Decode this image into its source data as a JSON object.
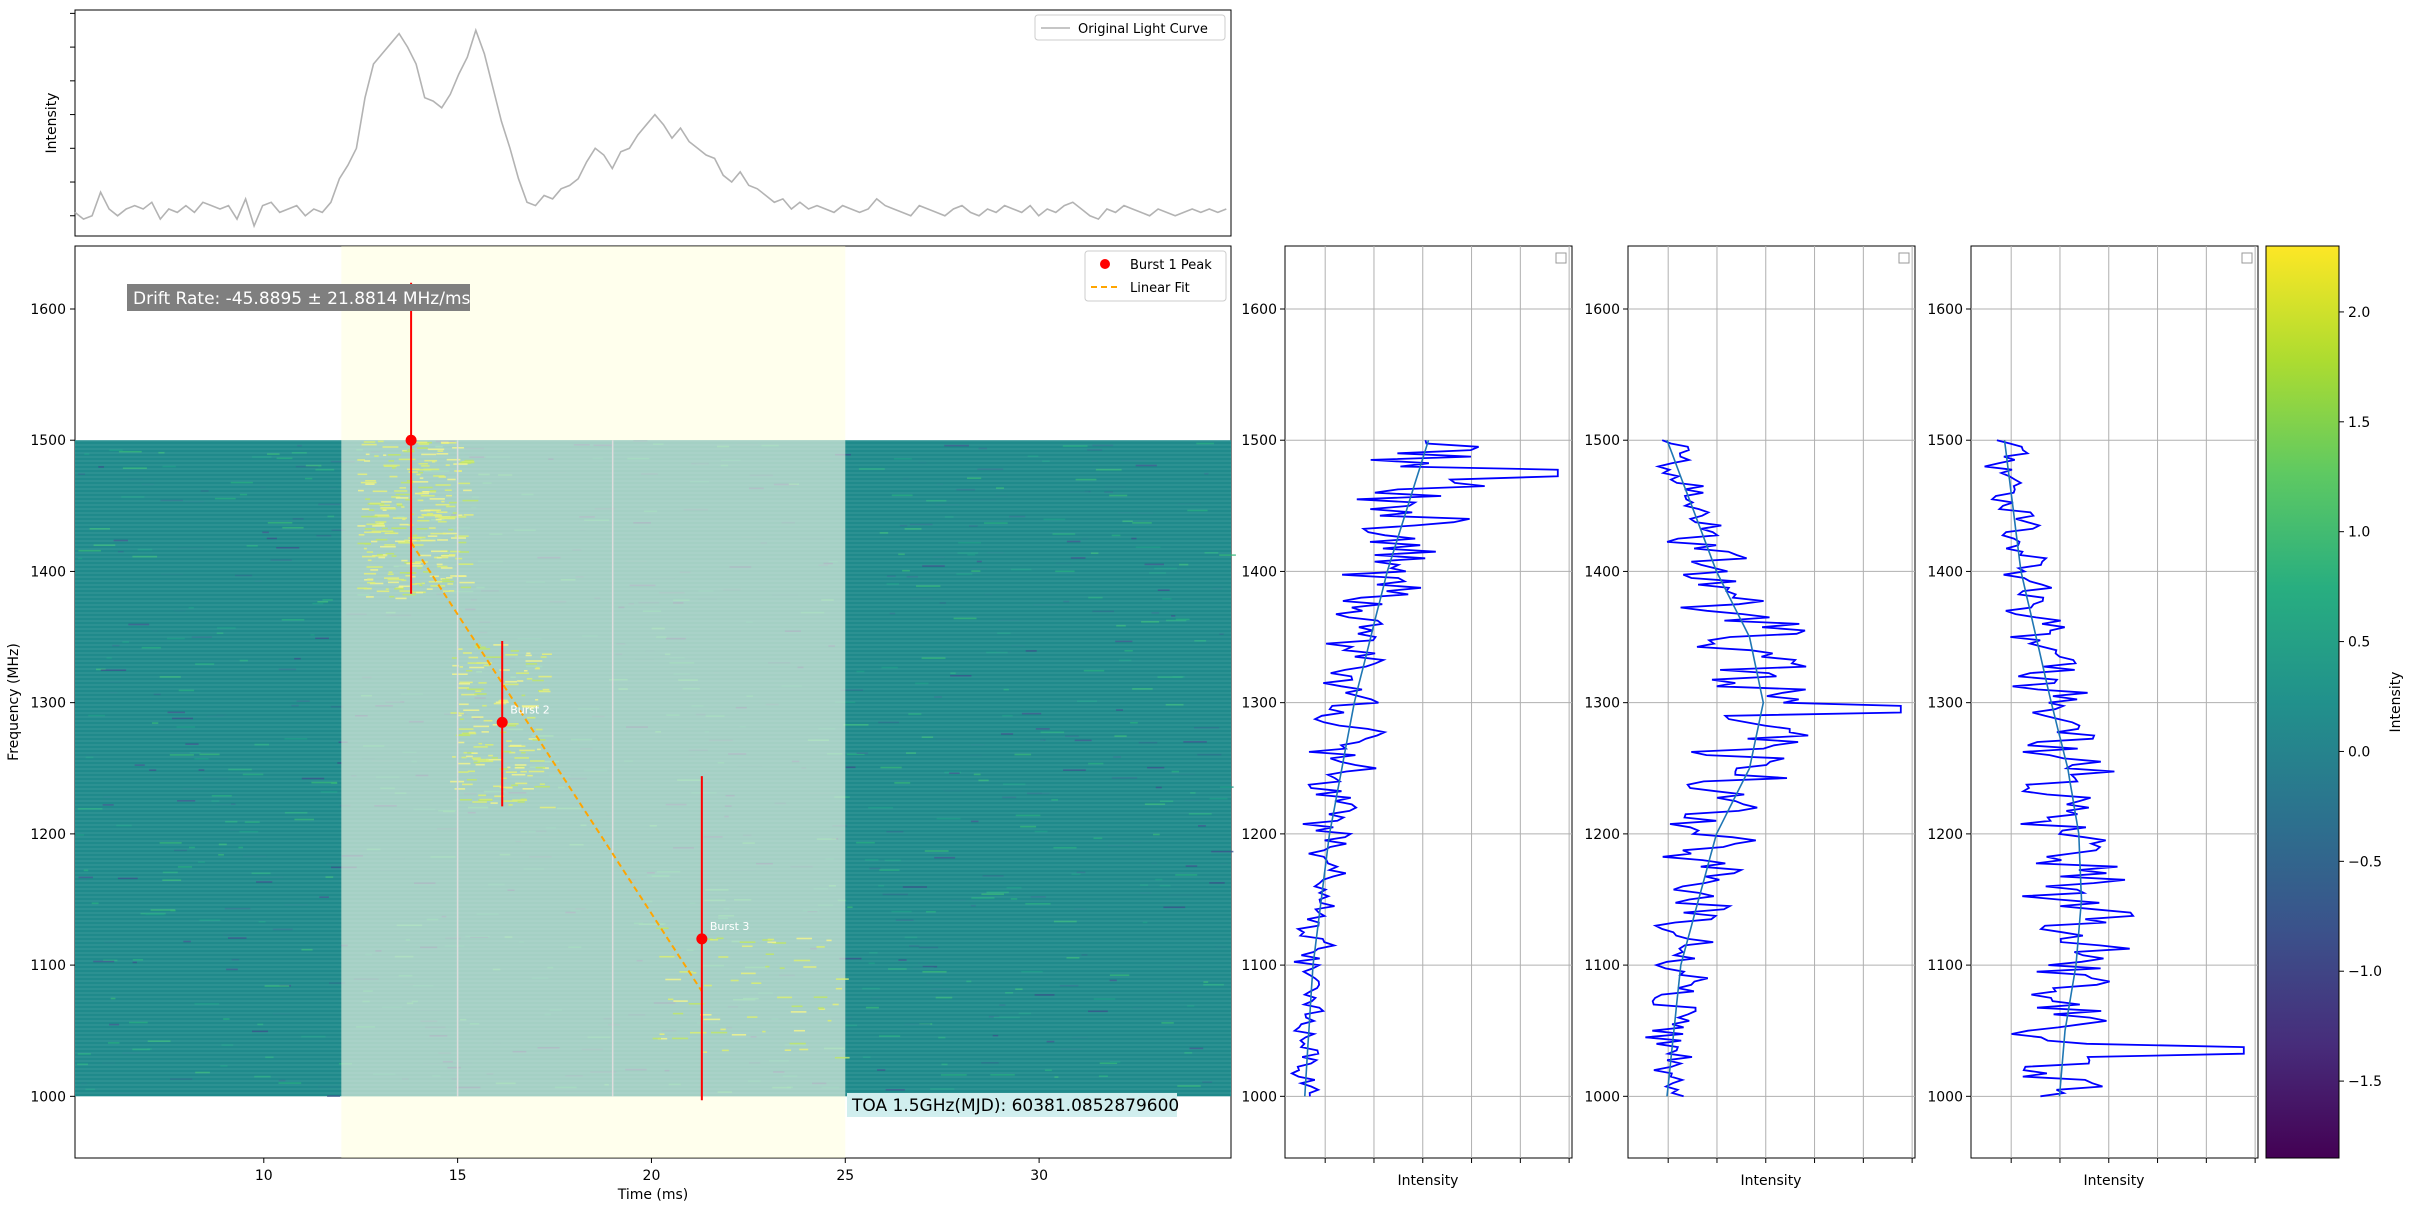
{
  "colors": {
    "light_curve": "#b3b3b3",
    "burst_peak": "#ff0000",
    "linear_fit": "#ffa500",
    "error_bar": "#ff0000",
    "spectrum": "#0000ff",
    "smooth": "#1f77b4",
    "highlight": "#ffffcc"
  },
  "chart_data": [
    {
      "type": "line",
      "panel": "light-curve",
      "ylabel": "Intensity",
      "legend": "top-right",
      "series": [
        {
          "name": "Original Light Curve",
          "x": [
            5.13,
            5.35,
            5.57,
            5.79,
            6.01,
            6.23,
            6.45,
            6.67,
            6.89,
            7.11,
            7.33,
            7.55,
            7.77,
            7.99,
            8.21,
            8.43,
            8.65,
            8.87,
            9.09,
            9.31,
            9.53,
            9.75,
            9.97,
            10.19,
            10.41,
            10.63,
            10.85,
            11.07,
            11.29,
            11.51,
            11.73,
            11.95,
            12.17,
            12.39,
            12.61,
            12.83,
            13.05,
            13.27,
            13.49,
            13.71,
            13.93,
            14.15,
            14.37,
            14.59,
            14.81,
            15.03,
            15.25,
            15.47,
            15.69,
            15.91,
            16.13,
            16.35,
            16.57,
            16.79,
            17.01,
            17.23,
            17.45,
            17.67,
            17.89,
            18.11,
            18.33,
            18.55,
            18.77,
            18.99,
            19.21,
            19.43,
            19.65,
            19.87,
            20.09,
            20.31,
            20.53,
            20.75,
            20.97,
            21.19,
            21.41,
            21.63,
            21.85,
            22.07,
            22.29,
            22.51,
            22.73,
            22.95,
            23.17,
            23.39,
            23.61,
            23.83,
            24.05,
            24.27,
            24.49,
            24.71,
            24.93,
            25.15,
            25.37,
            25.59,
            25.81,
            26.03,
            26.25,
            26.47,
            26.69,
            26.91,
            27.13,
            27.35,
            27.57,
            27.79,
            28.01,
            28.23,
            28.45,
            28.67,
            28.89,
            29.11,
            29.33,
            29.55,
            29.77,
            29.99,
            30.21,
            30.43,
            30.65,
            30.87,
            31.09,
            31.31,
            31.53,
            31.75,
            31.97,
            32.19,
            32.41,
            32.63,
            32.85,
            33.07,
            33.29,
            33.51,
            33.73,
            33.95,
            34.17,
            34.39,
            34.61,
            34.83
          ],
          "y": [
            0.11,
            0.09,
            0.1,
            0.17,
            0.12,
            0.1,
            0.12,
            0.13,
            0.12,
            0.14,
            0.09,
            0.12,
            0.11,
            0.13,
            0.11,
            0.14,
            0.13,
            0.12,
            0.13,
            0.09,
            0.15,
            0.07,
            0.13,
            0.14,
            0.11,
            0.12,
            0.13,
            0.1,
            0.12,
            0.11,
            0.14,
            0.21,
            0.25,
            0.3,
            0.45,
            0.55,
            0.58,
            0.61,
            0.64,
            0.6,
            0.55,
            0.45,
            0.44,
            0.42,
            0.46,
            0.52,
            0.57,
            0.65,
            0.58,
            0.48,
            0.38,
            0.3,
            0.21,
            0.14,
            0.13,
            0.16,
            0.15,
            0.18,
            0.19,
            0.21,
            0.26,
            0.3,
            0.28,
            0.24,
            0.29,
            0.3,
            0.34,
            0.37,
            0.4,
            0.37,
            0.33,
            0.36,
            0.32,
            0.3,
            0.28,
            0.27,
            0.22,
            0.2,
            0.23,
            0.19,
            0.18,
            0.16,
            0.14,
            0.15,
            0.12,
            0.14,
            0.12,
            0.13,
            0.12,
            0.11,
            0.13,
            0.12,
            0.11,
            0.12,
            0.15,
            0.13,
            0.12,
            0.11,
            0.1,
            0.13,
            0.12,
            0.11,
            0.1,
            0.12,
            0.13,
            0.11,
            0.1,
            0.12,
            0.11,
            0.13,
            0.12,
            0.11,
            0.13,
            0.1,
            0.12,
            0.11,
            0.13,
            0.14,
            0.12,
            0.1,
            0.09,
            0.12,
            0.11,
            0.13,
            0.12,
            0.11,
            0.1,
            0.12,
            0.11,
            0.1,
            0.11,
            0.12,
            0.11,
            0.12,
            0.11,
            0.12
          ]
        }
      ],
      "xlim": [
        5.13,
        34.95
      ],
      "ylim": [
        0.04,
        0.71
      ]
    },
    {
      "type": "heatmap",
      "panel": "dynamic-spectrum",
      "xlabel": "Time (ms)",
      "ylabel": "Frequency (MHz)",
      "xlim": [
        5.13,
        34.95
      ],
      "ylim": [
        953,
        1648
      ],
      "x_ticks": [
        10,
        15,
        20,
        25,
        30
      ],
      "y_ticks": [
        1000,
        1100,
        1200,
        1300,
        1400,
        1500,
        1600
      ],
      "data_extent": {
        "freq": [
          1000,
          1500
        ],
        "time": [
          5.13,
          34.95
        ]
      },
      "highlight_windows": [
        [
          12.0,
          25.0
        ]
      ],
      "component_dividers": [
        15.0,
        19.0
      ],
      "annotations": {
        "drift_rate": "Drift Rate: -45.8895 ± 21.8814 MHz/ms",
        "toa": "TOA 1.5GHz(MJD): 60381.0852879600"
      },
      "bursts": [
        {
          "time": 13.8,
          "freq": 1500,
          "err_low": 1383,
          "err_high": 1620,
          "label": ""
        },
        {
          "time": 16.15,
          "freq": 1285,
          "err_low": 1221,
          "err_high": 1347,
          "label": "Burst 2"
        },
        {
          "time": 21.3,
          "freq": 1120,
          "err_low": 997,
          "err_high": 1244,
          "label": "Burst 3"
        }
      ],
      "linear_fit": {
        "x": [
          13.8,
          21.3
        ],
        "y": [
          1422,
          1080
        ]
      },
      "legend": "top-right",
      "legend_entries": [
        "Burst 1 Peak",
        "Linear Fit"
      ],
      "colorbar": {
        "label": "Intensity",
        "range": [
          -1.85,
          2.3
        ],
        "ticks": [
          2.0,
          1.5,
          1.0,
          0.5,
          0.0,
          -0.5,
          -1.0,
          -1.5
        ],
        "tick_labels": [
          "2.0",
          "1.5",
          "1.0",
          "0.5",
          "0.0",
          "−0.5",
          "−1.0",
          "−1.5"
        ],
        "colormap": "viridis"
      }
    },
    {
      "type": "line",
      "panel": "spectrum-1",
      "xlabel": "Intensity",
      "ylim": [
        953,
        1648
      ],
      "y_ticks": [
        1000,
        1100,
        1200,
        1300,
        1400,
        1500,
        1600
      ],
      "peak_freq": 1475,
      "smooth": {
        "freq": [
          1000,
          1100,
          1200,
          1300,
          1400,
          1500
        ],
        "intensity": [
          0.05,
          0.08,
          0.14,
          0.23,
          0.35,
          0.5
        ]
      }
    },
    {
      "type": "line",
      "panel": "spectrum-2",
      "xlabel": "Intensity",
      "ylim": [
        953,
        1648
      ],
      "y_ticks": [
        1000,
        1100,
        1200,
        1300,
        1400,
        1500,
        1600
      ],
      "peak_freq": 1295,
      "smooth": {
        "freq": [
          1000,
          1100,
          1200,
          1250,
          1300,
          1350,
          1400,
          1500
        ],
        "intensity": [
          0.12,
          0.17,
          0.3,
          0.42,
          0.47,
          0.42,
          0.3,
          0.12
        ]
      }
    },
    {
      "type": "line",
      "panel": "spectrum-3",
      "xlabel": "Intensity",
      "ylim": [
        953,
        1648
      ],
      "y_ticks": [
        1000,
        1100,
        1200,
        1300,
        1400,
        1500,
        1600
      ],
      "peak_freq": 1035,
      "smooth": {
        "freq": [
          1000,
          1050,
          1100,
          1150,
          1200,
          1250,
          1300,
          1400,
          1500
        ],
        "intensity": [
          0.3,
          0.32,
          0.36,
          0.38,
          0.37,
          0.33,
          0.27,
          0.16,
          0.1
        ]
      }
    }
  ]
}
